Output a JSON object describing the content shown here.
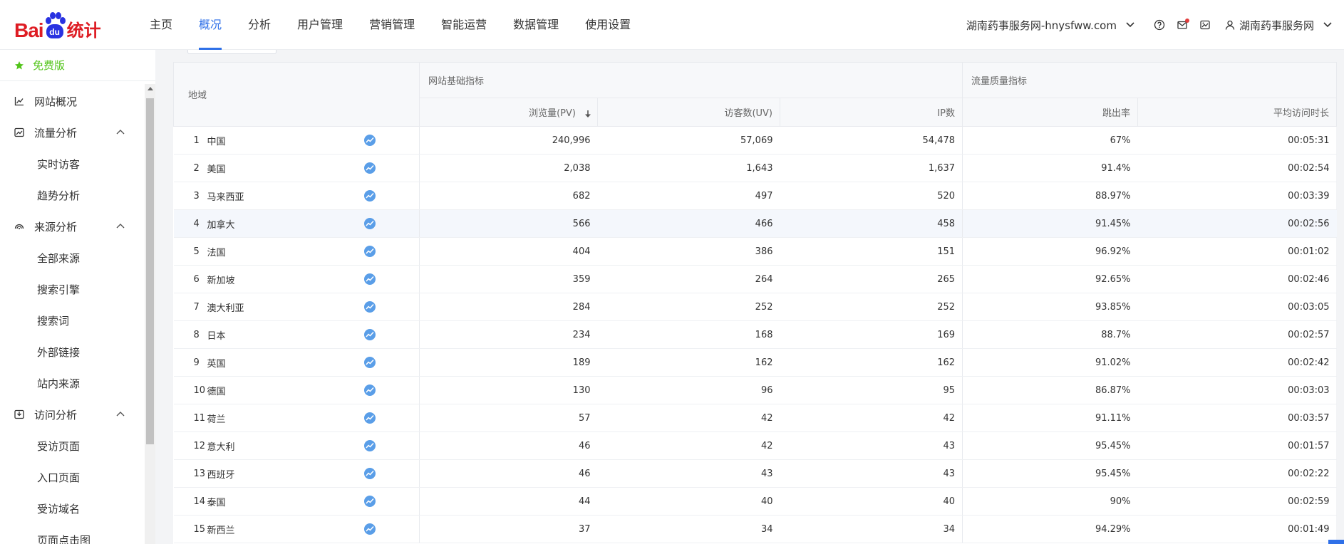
{
  "brand": {
    "logo_left": "Bai",
    "logo_paw": "du",
    "logo_right": "统计"
  },
  "nav": {
    "items": [
      {
        "label": "主页"
      },
      {
        "label": "概况"
      },
      {
        "label": "分析"
      },
      {
        "label": "用户管理"
      },
      {
        "label": "营销管理"
      },
      {
        "label": "智能运营"
      },
      {
        "label": "数据管理"
      },
      {
        "label": "使用设置"
      }
    ],
    "active_index": 1
  },
  "header": {
    "site_name": "湖南药事服务网-hnysfww.com",
    "user_name": "湖南药事服务网"
  },
  "sidebar": {
    "free_label": "免费版",
    "overview_label": "网站概况",
    "traffic_label": "流量分析",
    "traffic_items": [
      "实时访客",
      "趋势分析"
    ],
    "source_label": "来源分析",
    "source_items": [
      "全部来源",
      "搜索引擎",
      "搜索词",
      "外部链接",
      "站内来源"
    ],
    "visit_label": "访问分析",
    "visit_items": [
      "受访页面",
      "入口页面",
      "受访域名",
      "页面点击图"
    ]
  },
  "table": {
    "headers": {
      "region": "地域",
      "group_basic": "网站基础指标",
      "group_quality": "流量质量指标",
      "pv": "浏览量(PV)",
      "uv": "访客数(UV)",
      "ip": "IP数",
      "bounce": "跳出率",
      "duration": "平均访问时长"
    },
    "rows": [
      {
        "idx": "1",
        "region": "中国",
        "pv": "240,996",
        "uv": "57,069",
        "ip": "54,478",
        "bounce": "67%",
        "duration": "00:05:31"
      },
      {
        "idx": "2",
        "region": "美国",
        "pv": "2,038",
        "uv": "1,643",
        "ip": "1,637",
        "bounce": "91.4%",
        "duration": "00:02:54"
      },
      {
        "idx": "3",
        "region": "马来西亚",
        "pv": "682",
        "uv": "497",
        "ip": "520",
        "bounce": "88.97%",
        "duration": "00:03:39"
      },
      {
        "idx": "4",
        "region": "加拿大",
        "pv": "566",
        "uv": "466",
        "ip": "458",
        "bounce": "91.45%",
        "duration": "00:02:56"
      },
      {
        "idx": "5",
        "region": "法国",
        "pv": "404",
        "uv": "386",
        "ip": "151",
        "bounce": "96.92%",
        "duration": "00:01:02"
      },
      {
        "idx": "6",
        "region": "新加坡",
        "pv": "359",
        "uv": "264",
        "ip": "265",
        "bounce": "92.65%",
        "duration": "00:02:46"
      },
      {
        "idx": "7",
        "region": "澳大利亚",
        "pv": "284",
        "uv": "252",
        "ip": "252",
        "bounce": "93.85%",
        "duration": "00:03:05"
      },
      {
        "idx": "8",
        "region": "日本",
        "pv": "234",
        "uv": "168",
        "ip": "169",
        "bounce": "88.7%",
        "duration": "00:02:57"
      },
      {
        "idx": "9",
        "region": "英国",
        "pv": "189",
        "uv": "162",
        "ip": "162",
        "bounce": "91.02%",
        "duration": "00:02:42"
      },
      {
        "idx": "10",
        "region": "德国",
        "pv": "130",
        "uv": "96",
        "ip": "95",
        "bounce": "86.87%",
        "duration": "00:03:03"
      },
      {
        "idx": "11",
        "region": "荷兰",
        "pv": "57",
        "uv": "42",
        "ip": "42",
        "bounce": "91.11%",
        "duration": "00:03:57"
      },
      {
        "idx": "12",
        "region": "意大利",
        "pv": "46",
        "uv": "42",
        "ip": "43",
        "bounce": "95.45%",
        "duration": "00:01:57"
      },
      {
        "idx": "13",
        "region": "西班牙",
        "pv": "46",
        "uv": "43",
        "ip": "43",
        "bounce": "95.45%",
        "duration": "00:02:22"
      },
      {
        "idx": "14",
        "region": "泰国",
        "pv": "44",
        "uv": "40",
        "ip": "40",
        "bounce": "90%",
        "duration": "00:02:59"
      },
      {
        "idx": "15",
        "region": "新西兰",
        "pv": "37",
        "uv": "34",
        "ip": "34",
        "bounce": "94.29%",
        "duration": "00:01:49"
      }
    ],
    "highlighted_row_index": 3
  },
  "colors": {
    "accent": "#2f70e8",
    "brand_red": "#de1c23",
    "brand_blue": "#2932e1",
    "free_green": "#52c41a",
    "trend_icon": "#5a9ee8"
  },
  "icons": {
    "sort": "arrow-down-icon",
    "trend": "trend-chart-icon",
    "help": "help-circle-icon",
    "message": "mail-icon",
    "switch": "image-switch-icon",
    "user": "user-icon"
  }
}
